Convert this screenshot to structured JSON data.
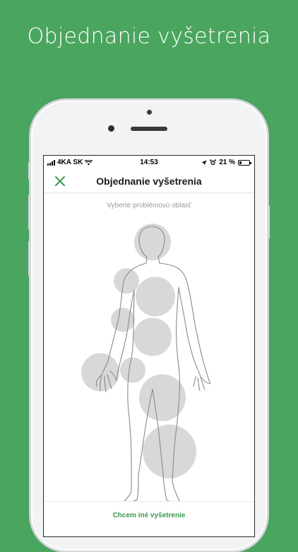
{
  "headline": "Objednanie vyšetrenia",
  "status_bar": {
    "carrier": "4KA SK",
    "time": "14:53",
    "battery_percent": "21 %",
    "battery_level": 0.21
  },
  "navbar": {
    "title": "Objednanie vyšetrenia",
    "close_icon": "close-icon"
  },
  "body_map": {
    "hint": "Vyberte problémovú oblasť"
  },
  "footer": {
    "other_exam_label": "Chcem iné vyšetrenie"
  },
  "colors": {
    "background": "#4aa55f",
    "accent": "#3a9a52",
    "zone_fill": "#d8d8d8"
  }
}
